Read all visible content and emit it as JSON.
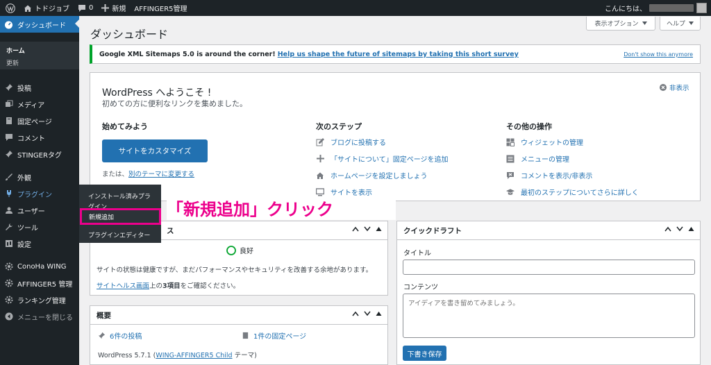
{
  "adminbar": {
    "site_name": "トドジョブ",
    "comments_count": "0",
    "new_label": "新規",
    "affinger_label": "AFFINGER5管理",
    "greeting": "こんにちは、"
  },
  "sidebar": {
    "dashboard": "ダッシュボード",
    "home": "ホーム",
    "updates": "更新",
    "posts": "投稿",
    "media": "メディア",
    "pages": "固定ページ",
    "comments": "コメント",
    "stinger_tags": "STINGERタグ",
    "appearance": "外観",
    "plugins": "プラグイン",
    "users": "ユーザー",
    "tools": "ツール",
    "settings": "設定",
    "conoha": "ConoHa WING",
    "affinger5": "AFFINGER5 管理",
    "ranking": "ランキング管理",
    "collapse": "メニューを閉じる"
  },
  "flyout": {
    "installed_line1": "インストール済みプラ",
    "installed_line2": "グイン",
    "add_new": "新規追加",
    "editor": "プラグインエディター"
  },
  "annotation": {
    "text": "「新規追加」クリック"
  },
  "header": {
    "title": "ダッシュボード",
    "screen_options": "表示オプション",
    "help": "ヘルプ"
  },
  "notice": {
    "text_bold": "Google XML Sitemaps 5.0 is around the corner!",
    "link": "Help us shape the future of sitemaps by taking this short survey",
    "dismiss": "Don't show this anymore"
  },
  "welcome": {
    "title": "WordPress へようこそ !",
    "subtitle": "初めての方に便利なリンクを集めました。",
    "dismiss": "非表示",
    "col1_title": "始めてみよう",
    "customize_button": "サイトをカスタマイズ",
    "or_text": "または、",
    "change_theme": "別のテーマに変更する",
    "col2_title": "次のステップ",
    "next_steps": [
      "ブログに投稿する",
      "「サイトについて」固定ページを追加",
      "ホームページを設定しましょう",
      "サイトを表示"
    ],
    "col3_title": "その他の操作",
    "more_actions": [
      "ウィジェットの管理",
      "メニューの管理",
      "コメントを表示/非表示",
      "最初のステップについてさらに詳しく"
    ]
  },
  "site_health": {
    "title_fragment": "ス",
    "status": "良好",
    "description": "サイトの状態は健康ですが、まだパフォーマンスやセキュリティを改善する余地があります。",
    "link": "サイトヘルス画面",
    "link_suffix_1": "上の",
    "items_count": "3項目",
    "link_suffix_2": "をご確認ください。"
  },
  "glance": {
    "title": "概要",
    "posts_count": "6件の投稿",
    "pages_count": "1件の固定ページ",
    "wp_version_prefix": "WordPress 5.7.1 (",
    "theme_link": "WING-AFFINGER5 Child",
    "wp_version_suffix": " テーマ)"
  },
  "quick_draft": {
    "title": "クイックドラフト",
    "title_label": "タイトル",
    "title_value": "",
    "content_label": "コンテンツ",
    "content_placeholder": "アイディアを書き留めてみましょう。",
    "save_button": "下書き保存"
  },
  "colors": {
    "accent": "#2271b1",
    "admin_dark": "#1d2327",
    "highlight_pink": "#ec008c",
    "good_green": "#00a32a"
  }
}
